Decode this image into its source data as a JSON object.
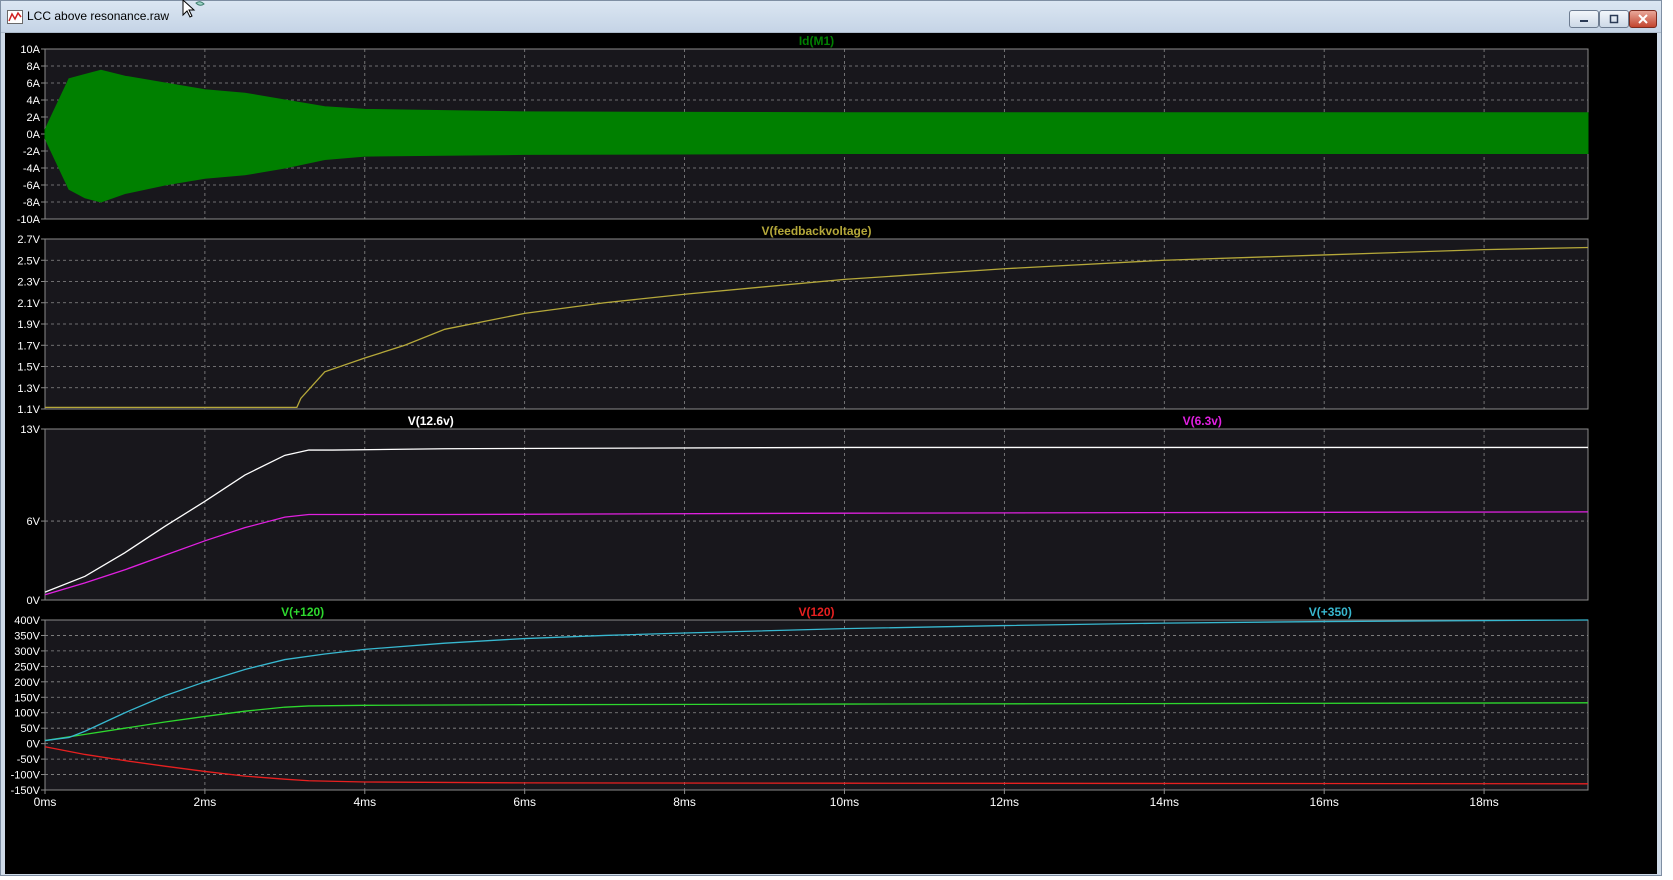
{
  "window": {
    "title": "LCC above resonance.raw"
  },
  "icons": {
    "app": "waveform-app-icon",
    "cursor": "mouse-cursor-icon",
    "minimize": "minimize-icon",
    "maximize": "maximize-icon",
    "close": "close-icon"
  },
  "colors": {
    "background": "#000000",
    "panel_bg": "#18171c",
    "grid": "#8a8a8a",
    "axis_text": "#ffffff",
    "id_m1": "#008000",
    "feedback": "#b5a83a",
    "v12_6": "#ffffff",
    "v6_3": "#e020e0",
    "v_plus120": "#2ed82e",
    "v_120": "#e82020",
    "v_plus350": "#38b8d0"
  },
  "chart_data": [
    {
      "type": "line",
      "series": [
        {
          "name": "Id(M1)",
          "color": "#008000",
          "envelope": {
            "x_ms": [
              0,
              0.3,
              0.5,
              0.7,
              1.0,
              1.5,
              2.0,
              2.5,
              3.0,
              3.5,
              4.0,
              6.0,
              10.0,
              14.0,
              19.3
            ],
            "upper_A": [
              0.5,
              6.5,
              7.0,
              7.5,
              6.8,
              6.0,
              5.2,
              4.8,
              4.0,
              3.2,
              2.9,
              2.6,
              2.5,
              2.5,
              2.5
            ],
            "lower_A": [
              -0.5,
              -6.5,
              -7.5,
              -8.0,
              -7.0,
              -6.0,
              -5.2,
              -4.8,
              -4.0,
              -3.0,
              -2.6,
              -2.4,
              -2.3,
              -2.3,
              -2.3
            ]
          }
        }
      ],
      "xlim": [
        0,
        19.3
      ],
      "ylim": [
        -10,
        10
      ],
      "yticks": [
        10,
        8,
        6,
        4,
        2,
        0,
        -2,
        -4,
        -6,
        -8,
        -10
      ],
      "ytick_labels": [
        "10A",
        "8A",
        "6A",
        "4A",
        "2A",
        "0A",
        "-2A",
        "-4A",
        "-6A",
        "-8A",
        "-10A"
      ],
      "grid": true
    },
    {
      "type": "line",
      "series": [
        {
          "name": "V(feedbackvoltage)",
          "color": "#b5a83a",
          "x": [
            0,
            1.0,
            2.0,
            3.15,
            3.2,
            3.5,
            4.0,
            4.5,
            5.0,
            6.0,
            7.0,
            8.0,
            9.0,
            10.0,
            12.0,
            14.0,
            16.0,
            18.0,
            19.3
          ],
          "y": [
            1.115,
            1.115,
            1.115,
            1.115,
            1.2,
            1.45,
            1.58,
            1.7,
            1.85,
            2.0,
            2.1,
            2.18,
            2.25,
            2.32,
            2.42,
            2.5,
            2.55,
            2.6,
            2.62
          ]
        }
      ],
      "xlim": [
        0,
        19.3
      ],
      "ylim": [
        1.1,
        2.7
      ],
      "yticks": [
        2.7,
        2.5,
        2.3,
        2.1,
        1.9,
        1.7,
        1.5,
        1.3,
        1.1
      ],
      "ytick_labels": [
        "2.7V",
        "2.5V",
        "2.3V",
        "2.1V",
        "1.9V",
        "1.7V",
        "1.5V",
        "1.3V",
        "1.1V"
      ],
      "grid": true
    },
    {
      "type": "line",
      "series": [
        {
          "name": "V(12.6v)",
          "color": "#ffffff",
          "x": [
            0,
            0.5,
            1.0,
            1.5,
            2.0,
            2.5,
            3.0,
            3.3,
            3.6,
            5.0,
            10.0,
            15.0,
            19.3
          ],
          "y": [
            0.6,
            1.8,
            3.6,
            5.6,
            7.5,
            9.5,
            11.0,
            11.4,
            11.4,
            11.5,
            11.6,
            11.6,
            11.6
          ]
        },
        {
          "name": "V(6.3v)",
          "color": "#e020e0",
          "x": [
            0,
            0.5,
            1.0,
            1.5,
            2.0,
            2.5,
            3.0,
            3.3,
            5.0,
            10.0,
            19.3
          ],
          "y": [
            0.4,
            1.3,
            2.3,
            3.4,
            4.5,
            5.5,
            6.3,
            6.5,
            6.5,
            6.6,
            6.7
          ]
        }
      ],
      "xlim": [
        0,
        19.3
      ],
      "ylim": [
        0,
        13
      ],
      "yticks": [
        13,
        6,
        0
      ],
      "ytick_labels": [
        "13V",
        "6V",
        "0V"
      ],
      "grid": true
    },
    {
      "type": "line",
      "series": [
        {
          "name": "V(+120)",
          "color": "#2ed82e",
          "x": [
            0,
            0.5,
            1.0,
            1.5,
            2.0,
            2.5,
            3.0,
            3.3,
            4.0,
            6.0,
            10.0,
            15.0,
            19.3
          ],
          "y": [
            10,
            30,
            50,
            70,
            88,
            105,
            118,
            122,
            124,
            126,
            128,
            130,
            132
          ]
        },
        {
          "name": "V(120)",
          "color": "#e82020",
          "x": [
            0,
            0.5,
            1.0,
            1.5,
            2.0,
            2.5,
            3.0,
            3.3,
            4.0,
            6.0,
            10.0,
            15.0,
            19.3
          ],
          "y": [
            -10,
            -35,
            -55,
            -73,
            -90,
            -105,
            -115,
            -120,
            -124,
            -127,
            -128,
            -129,
            -130
          ]
        },
        {
          "name": "V(+350)",
          "color": "#38b8d0",
          "x": [
            0,
            0.3,
            0.5,
            1.0,
            1.5,
            2.0,
            2.5,
            3.0,
            3.5,
            4.0,
            5.0,
            6.0,
            7.0,
            8.0,
            10.0,
            12.0,
            14.0,
            16.0,
            19.3
          ],
          "y": [
            10,
            20,
            40,
            100,
            155,
            200,
            240,
            272,
            290,
            305,
            325,
            340,
            350,
            358,
            372,
            382,
            390,
            395,
            400
          ]
        }
      ],
      "xlim": [
        0,
        19.3
      ],
      "ylim": [
        -150,
        400
      ],
      "yticks": [
        400,
        350,
        300,
        250,
        200,
        150,
        100,
        50,
        0,
        -50,
        -100,
        -150
      ],
      "ytick_labels": [
        "400V",
        "350V",
        "300V",
        "250V",
        "200V",
        "150V",
        "100V",
        "50V",
        "0V",
        "-50V",
        "-100V",
        "-150V"
      ],
      "grid": true
    }
  ],
  "x_axis": {
    "ticks": [
      0,
      2,
      4,
      6,
      8,
      10,
      12,
      14,
      16,
      18
    ],
    "tick_labels": [
      "0ms",
      "2ms",
      "4ms",
      "6ms",
      "8ms",
      "10ms",
      "12ms",
      "14ms",
      "16ms",
      "18ms"
    ]
  }
}
